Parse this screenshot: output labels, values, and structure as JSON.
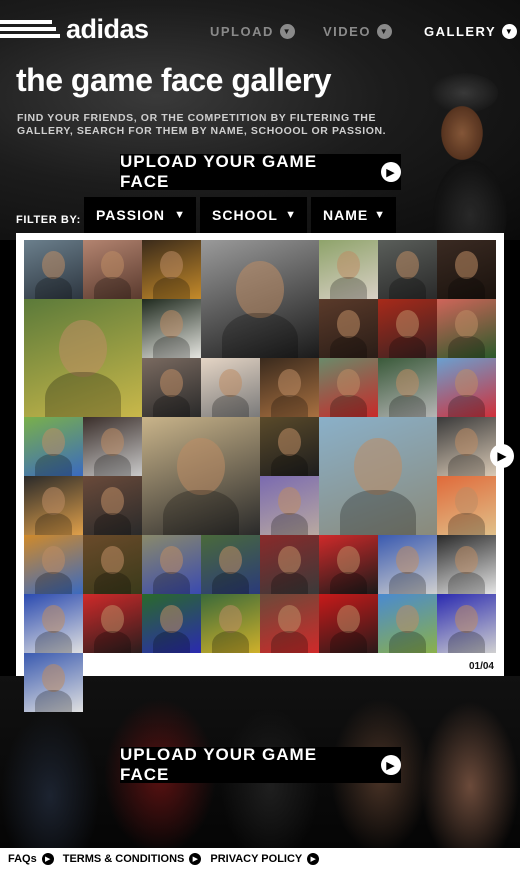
{
  "brand": {
    "wordmark": "adidas"
  },
  "nav": [
    {
      "label": "UPLOAD",
      "state": "inactive"
    },
    {
      "label": "VIDEO",
      "state": "inactive"
    },
    {
      "label": "GALLERY",
      "state": "active"
    }
  ],
  "hero": {
    "title": "the game face gallery",
    "subtitle": "FIND YOUR FRIENDS, OR THE COMPETITION BY FILTERING THE GALLERY, SEARCH FOR THEM BY NAME, SCHOOOL OR PASSION.",
    "upload_label": "UPLOAD YOUR GAME FACE"
  },
  "filters": {
    "label": "FILTER BY:",
    "options": [
      "PASSION",
      "SCHOOL",
      "NAME"
    ]
  },
  "gallery": {
    "page": "01/04",
    "tiles": [
      {
        "big": false,
        "colors": [
          "#6b7f8c",
          "#2d3640"
        ]
      },
      {
        "big": false,
        "colors": [
          "#b38470",
          "#5a3a2e"
        ]
      },
      {
        "big": false,
        "colors": [
          "#3a2a1a",
          "#c48a2a"
        ]
      },
      {
        "big": true,
        "colors": [
          "#9a9a9a",
          "#1a1a1a"
        ]
      },
      {
        "big": false,
        "colors": [
          "#8ea36a",
          "#d9d0c5"
        ]
      },
      {
        "big": false,
        "colors": [
          "#5a5e5a",
          "#2a2a2a"
        ]
      },
      {
        "big": false,
        "colors": [
          "#3a2a22",
          "#1a120d"
        ]
      },
      {
        "big": true,
        "colors": [
          "#5b7a3a",
          "#c9b84a"
        ]
      },
      {
        "big": false,
        "colors": [
          "#1f2a1e",
          "#e5e5e0"
        ]
      },
      {
        "big": false,
        "colors": [
          "#5a3a2a",
          "#2a1d17"
        ]
      },
      {
        "big": false,
        "colors": [
          "#a82a1a",
          "#3a2222"
        ]
      },
      {
        "big": false,
        "colors": [
          "#d0655a",
          "#2a5a2a"
        ]
      },
      {
        "big": false,
        "colors": [
          "#7a6a60",
          "#2a2a2a"
        ]
      },
      {
        "big": false,
        "colors": [
          "#e5d5c5",
          "#7a7a7a"
        ]
      },
      {
        "big": false,
        "colors": [
          "#3a2a1d",
          "#a87040"
        ]
      },
      {
        "big": false,
        "colors": [
          "#6a8a6a",
          "#c82a2a"
        ]
      },
      {
        "big": false,
        "colors": [
          "#3a5a3a",
          "#b5b5b5"
        ]
      },
      {
        "big": false,
        "colors": [
          "#6aa0d0",
          "#d0303a"
        ]
      },
      {
        "big": false,
        "colors": [
          "#7ab04a",
          "#3a6ac0"
        ]
      },
      {
        "big": false,
        "colors": [
          "#3a2e2a",
          "#c9c9c9"
        ]
      },
      {
        "big": true,
        "colors": [
          "#c9b48a",
          "#2a2a2a"
        ]
      },
      {
        "big": false,
        "colors": [
          "#5a4a2a",
          "#1d1d1d"
        ]
      },
      {
        "big": true,
        "colors": [
          "#8ab0c9",
          "#8a8a7a"
        ]
      },
      {
        "big": false,
        "colors": [
          "#3a3a3a",
          "#d9c9b5"
        ]
      },
      {
        "big": false,
        "colors": [
          "#2a2a2a",
          "#e0a04a"
        ]
      },
      {
        "big": false,
        "colors": [
          "#6a4a3a",
          "#2a2a2a"
        ]
      },
      {
        "big": false,
        "colors": [
          "#7a6ab0",
          "#b9a9a0"
        ]
      },
      {
        "big": false,
        "colors": [
          "#e06a3a",
          "#e0c08a"
        ]
      },
      {
        "big": false,
        "colors": [
          "#d08a2a",
          "#3a6ac0"
        ]
      },
      {
        "big": false,
        "colors": [
          "#6a4a2a",
          "#3a3a1a"
        ]
      },
      {
        "big": false,
        "colors": [
          "#8a8a6a",
          "#3a4ab0"
        ]
      },
      {
        "big": false,
        "colors": [
          "#4a6a3a",
          "#2a3a7a"
        ]
      },
      {
        "big": false,
        "colors": [
          "#8a2a2a",
          "#3a3a3a"
        ]
      },
      {
        "big": false,
        "colors": [
          "#d02a2a",
          "#1a1a1a"
        ]
      },
      {
        "big": false,
        "colors": [
          "#3a5ab0",
          "#cfcfcf"
        ]
      },
      {
        "big": false,
        "colors": [
          "#2a2a2a",
          "#e5e5e5"
        ]
      },
      {
        "big": false,
        "colors": [
          "#2a4ab0",
          "#e0e0e0"
        ]
      },
      {
        "big": false,
        "colors": [
          "#d02a2a",
          "#2a1d1d"
        ]
      },
      {
        "big": false,
        "colors": [
          "#2a6a2a",
          "#2a2ab0"
        ]
      },
      {
        "big": false,
        "colors": [
          "#3a6a3a",
          "#d0b02a"
        ]
      },
      {
        "big": false,
        "colors": [
          "#6a4a3a",
          "#d02a2a"
        ]
      },
      {
        "big": false,
        "colors": [
          "#c81a1a",
          "#2a1a1a"
        ]
      },
      {
        "big": false,
        "colors": [
          "#4a8ad0",
          "#8ab04a"
        ]
      },
      {
        "big": false,
        "colors": [
          "#2a2ab0",
          "#d0d0d0"
        ]
      },
      {
        "big": false,
        "colors": [
          "#3a5ab0",
          "#e0e0e0"
        ]
      }
    ]
  },
  "footer": {
    "links": [
      "FAQs",
      "TERMS & CONDITIONS",
      "PRIVACY POLICY"
    ]
  },
  "colors": {
    "background": "#000000",
    "button": "#000000",
    "panel": "#ffffff",
    "nav_inactive": "#8a8a8a"
  },
  "icons": {
    "nav": "chevron-down-circle-icon",
    "upload": "arrow-right-circle-icon",
    "filter": "caret-down-icon",
    "pager": "next-arrow-icon",
    "footer": "arrow-right-circle-icon"
  }
}
